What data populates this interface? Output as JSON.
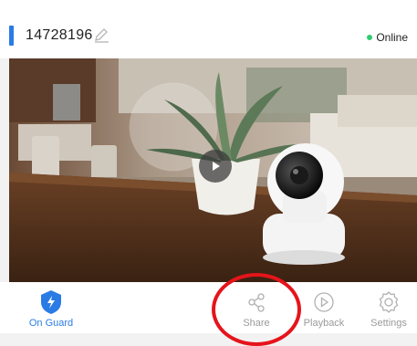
{
  "device": {
    "name": "14728196",
    "status": "Online",
    "status_color": "#2ecc71"
  },
  "video": {
    "play_icon": "play-icon"
  },
  "nav": [
    {
      "label": "On Guard",
      "icon": "shield-bolt-icon",
      "active": true
    },
    {
      "label": "Share",
      "icon": "share-icon",
      "active": false
    },
    {
      "label": "Playback",
      "icon": "playback-icon",
      "active": false
    },
    {
      "label": "Settings",
      "icon": "gear-icon",
      "active": false
    }
  ],
  "colors": {
    "accent": "#2b7be5",
    "annotation": "#e5141b"
  }
}
